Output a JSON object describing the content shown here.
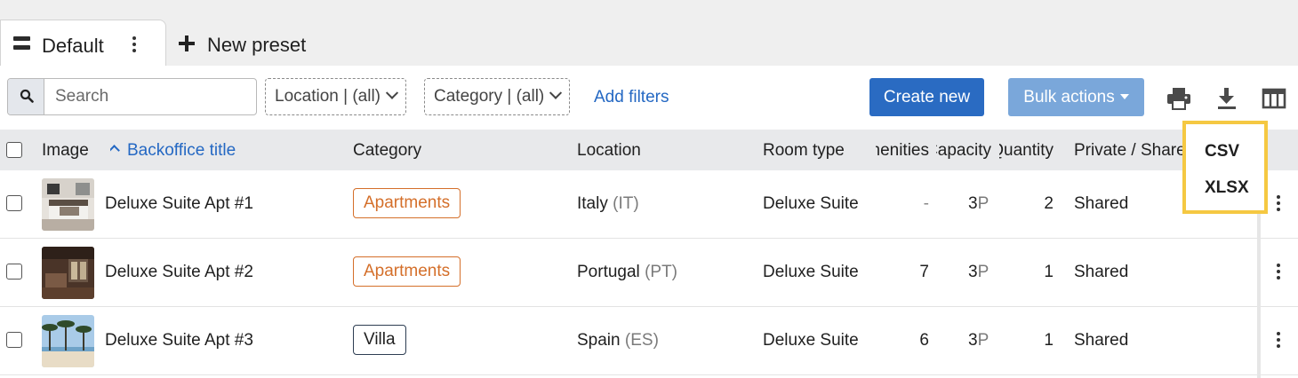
{
  "tabs": {
    "default_label": "Default",
    "new_preset_label": "New preset"
  },
  "toolbar": {
    "search_placeholder": "Search",
    "filter_location": "Location | (all)",
    "filter_category": "Category | (all)",
    "add_filters": "Add filters",
    "create_new": "Create new",
    "bulk_actions": "Bulk actions",
    "icons": [
      "search-icon",
      "print-icon",
      "download-icon",
      "columns-icon"
    ]
  },
  "columns": {
    "image": "Image",
    "title": "Backoffice title",
    "category": "Category",
    "location": "Location",
    "room_type": "Room type",
    "amenities": "Amenities",
    "capacity": "Capacity",
    "quantity": "Quantity",
    "private_shared": "Private / Shared"
  },
  "rows": [
    {
      "title": "Deluxe Suite Apt #1",
      "category": "Apartments",
      "country": "Italy",
      "code": "(IT)",
      "room_type": "Deluxe Suite",
      "amenities": "-",
      "capacity": "3",
      "capacity_unit": "P",
      "quantity": "2",
      "private_shared": "Shared"
    },
    {
      "title": "Deluxe Suite Apt #2",
      "category": "Apartments",
      "country": "Portugal",
      "code": "(PT)",
      "room_type": "Deluxe Suite",
      "amenities": "7",
      "capacity": "3",
      "capacity_unit": "P",
      "quantity": "1",
      "private_shared": "Shared"
    },
    {
      "title": "Deluxe Suite Apt #3",
      "category": "Villa",
      "country": "Spain",
      "code": "(ES)",
      "room_type": "Deluxe Suite",
      "amenities": "6",
      "capacity": "3",
      "capacity_unit": "P",
      "quantity": "1",
      "private_shared": "Shared"
    }
  ],
  "export_menu": {
    "items": [
      "CSV",
      "XLSX"
    ]
  },
  "colors": {
    "accent": "#2a6bc2",
    "bulk": "#7aa7da",
    "highlight": "#f5c842",
    "badge_orange": "#d46f2a"
  }
}
